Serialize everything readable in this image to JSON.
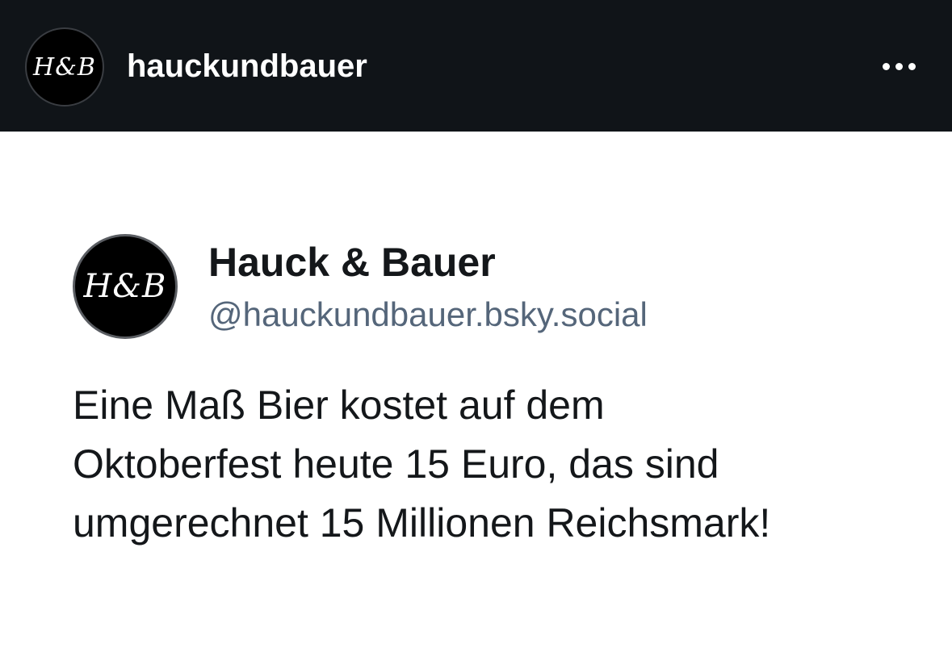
{
  "header": {
    "avatar_logo": "H&B",
    "username": "hauckundbauer",
    "more_icon": "more-horizontal-icon",
    "background": "#101418"
  },
  "post": {
    "avatar_logo": "H&B",
    "display_name": "Hauck & Bauer",
    "handle": "@hauckundbauer.bsky.social",
    "text_lines": [
      "Eine Maß Bier kostet auf dem",
      "Oktoberfest heute 15 Euro, das sind",
      "umgerechnet 15 Millionen Reichsmark!"
    ],
    "text_color": "#14171a",
    "handle_color": "#55667a"
  }
}
